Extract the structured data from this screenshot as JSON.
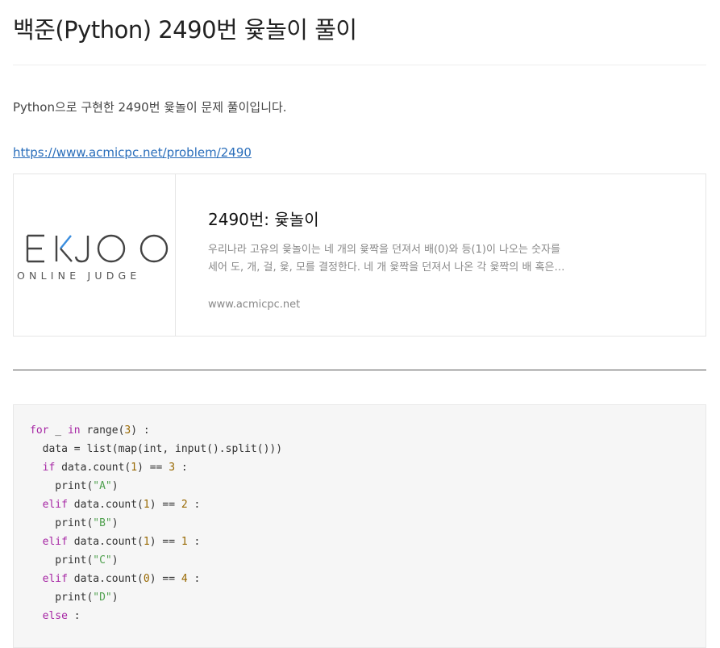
{
  "post": {
    "title": "백준(Python) 2490번 윷놀이 풀이",
    "intro": "Python으로 구현한 2490번 윷놀이 문제 풀이입니다.",
    "link": "https://www.acmicpc.net/problem/2490"
  },
  "og_card": {
    "logo_main": "EKJOO",
    "logo_sub": "ONLINE JUDGE",
    "title": "2490번: 윷놀이",
    "desc_lines": [
      "우리나라 고유의 윷놀이는 네 개의 윷짝을 던져서 배(0)와 등(1)이 나오는 숫자를",
      "세어 도, 개, 걸, 윷, 모를 결정한다. 네 개 윷짝을 던져서 나온 각 윷짝의 배 혹은…"
    ],
    "url": "www.acmicpc.net"
  },
  "code": {
    "language": "python",
    "lines": [
      [
        {
          "t": "kw",
          "v": "for"
        },
        {
          "t": "plain",
          "v": " _ "
        },
        {
          "t": "kw",
          "v": "in"
        },
        {
          "t": "plain",
          "v": " range("
        },
        {
          "t": "num",
          "v": "3"
        },
        {
          "t": "plain",
          "v": ") :"
        }
      ],
      [
        {
          "t": "plain",
          "v": "  data = list(map(int, input().split()))"
        }
      ],
      [
        {
          "t": "kw",
          "v": "  if"
        },
        {
          "t": "plain",
          "v": " data.count("
        },
        {
          "t": "num",
          "v": "1"
        },
        {
          "t": "plain",
          "v": ") == "
        },
        {
          "t": "num",
          "v": "3"
        },
        {
          "t": "plain",
          "v": " :"
        }
      ],
      [
        {
          "t": "plain",
          "v": "    print("
        },
        {
          "t": "str",
          "v": "\"A\""
        },
        {
          "t": "plain",
          "v": ")"
        }
      ],
      [
        {
          "t": "kw",
          "v": "  elif"
        },
        {
          "t": "plain",
          "v": " data.count("
        },
        {
          "t": "num",
          "v": "1"
        },
        {
          "t": "plain",
          "v": ") == "
        },
        {
          "t": "num",
          "v": "2"
        },
        {
          "t": "plain",
          "v": " :"
        }
      ],
      [
        {
          "t": "plain",
          "v": "    print("
        },
        {
          "t": "str",
          "v": "\"B\""
        },
        {
          "t": "plain",
          "v": ")"
        }
      ],
      [
        {
          "t": "kw",
          "v": "  elif"
        },
        {
          "t": "plain",
          "v": " data.count("
        },
        {
          "t": "num",
          "v": "1"
        },
        {
          "t": "plain",
          "v": ") == "
        },
        {
          "t": "num",
          "v": "1"
        },
        {
          "t": "plain",
          "v": " :"
        }
      ],
      [
        {
          "t": "plain",
          "v": "    print("
        },
        {
          "t": "str",
          "v": "\"C\""
        },
        {
          "t": "plain",
          "v": ")"
        }
      ],
      [
        {
          "t": "kw",
          "v": "  elif"
        },
        {
          "t": "plain",
          "v": " data.count("
        },
        {
          "t": "num",
          "v": "0"
        },
        {
          "t": "plain",
          "v": ") == "
        },
        {
          "t": "num",
          "v": "4"
        },
        {
          "t": "plain",
          "v": " :"
        }
      ],
      [
        {
          "t": "plain",
          "v": "    print("
        },
        {
          "t": "str",
          "v": "\"D\""
        },
        {
          "t": "plain",
          "v": ")"
        }
      ],
      [
        {
          "t": "kw",
          "v": "  else"
        },
        {
          "t": "plain",
          "v": " :"
        }
      ]
    ]
  },
  "colors": {
    "keyword": "#a626a4",
    "number": "#986801",
    "string": "#50a14f",
    "link": "#2a6ebb",
    "logo_accent": "#3a8dde"
  }
}
